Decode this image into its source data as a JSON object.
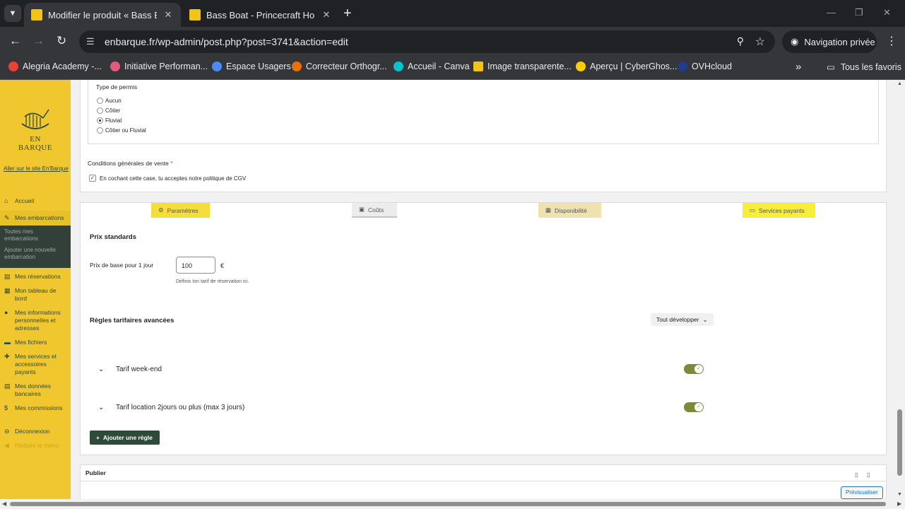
{
  "browser": {
    "tabs": [
      {
        "title": "Modifier le produit « Bass Boat",
        "close": "✕"
      },
      {
        "title": "Bass Boat - Princecraft Holiday",
        "close": "✕"
      }
    ],
    "new_tab": "+",
    "url": "enbarque.fr/wp-admin/post.php?post=3741&action=edit",
    "incognito_label": "Navigation privée",
    "bookmarks": [
      {
        "label": "Alegria Academy -...",
        "color": "#e94235"
      },
      {
        "label": "Initiative Performan...",
        "color": "#e25b7a"
      },
      {
        "label": "Espace Usagers",
        "color": "#4c8bf5"
      },
      {
        "label": "Correcteur Orthogr...",
        "color": "#e8710a"
      },
      {
        "label": "Accueil - Canva",
        "color": "#00c4cc"
      },
      {
        "label": "Image transparente...",
        "color": "#f0c419"
      },
      {
        "label": "Aperçu | CyberGhos...",
        "color": "#ffcc00"
      },
      {
        "label": "OVHcloud",
        "color": "#1f3c88"
      }
    ],
    "all_bookmarks": "Tous les favoris"
  },
  "sidebar": {
    "logo_text": "EN BARQUE",
    "site_link": "Aller sur le site En'Barque",
    "menu": [
      {
        "label": "Accueil",
        "icon": "home-icon",
        "glyph": "⌂"
      },
      {
        "label": "Mes embarcations",
        "icon": "pin-icon",
        "glyph": "✎",
        "active": true
      },
      {
        "label": "Mes réservations",
        "icon": "list-icon",
        "glyph": "▤"
      },
      {
        "label": "Mon tableau de bord",
        "icon": "dashboard-icon",
        "glyph": "▦"
      },
      {
        "label": "Mes informations personnelles et adresses",
        "icon": "user-icon",
        "glyph": "●"
      },
      {
        "label": "Mes fichiers",
        "icon": "folder-icon",
        "glyph": "▬"
      },
      {
        "label": "Mes services et accessoires payants",
        "icon": "tools-icon",
        "glyph": "✚"
      },
      {
        "label": "Mes données bancaires",
        "icon": "bank-icon",
        "glyph": "▤"
      },
      {
        "label": "Mes commissions",
        "icon": "dollar-icon",
        "glyph": "$"
      },
      {
        "label": "Déconnexion",
        "icon": "logout-icon",
        "glyph": "⊖"
      },
      {
        "label": "Réduire le menu",
        "icon": "collapse-icon",
        "glyph": "◀"
      }
    ],
    "submenu": [
      "Toutes mes embarcations",
      "Ajouter une nouvelle embarcation"
    ]
  },
  "form": {
    "permis_title": "Type de permis",
    "permis_options": [
      "Aucun",
      "Côtier",
      "Fluvial",
      "Côtier ou Fluvial"
    ],
    "permis_selected": "Fluvial",
    "cgv_label": "Conditions générales de vente",
    "cgv_required": "*",
    "cgv_checkbox": "En cochant cette case, tu acceptes notre politique de CGV",
    "cgv_checked": true
  },
  "product_tabs": [
    {
      "label": "Paramètres",
      "icon": "gear-icon",
      "glyph": "⚙"
    },
    {
      "label": "Coûts",
      "icon": "money-icon",
      "glyph": "▣"
    },
    {
      "label": "Disponibilité",
      "icon": "calendar-icon",
      "glyph": "▦"
    },
    {
      "label": "Services payants",
      "icon": "box-icon",
      "glyph": "▭"
    }
  ],
  "pricing": {
    "section_title": "Prix standards",
    "base_price_label": "Prix de base pour 1 jour",
    "base_price_value": "100",
    "currency": "€",
    "hint": "Définis ton tarif de réservation ici.",
    "advanced_title": "Règles tarifaires avancées",
    "expand_all": "Tout développer",
    "rules": [
      {
        "label": "Tarif week-end",
        "enabled": true
      },
      {
        "label": "Tarif location 2jours ou plus (max 3 jours)",
        "enabled": true
      }
    ],
    "add_rule": "Ajouter une règle"
  },
  "publish": {
    "title": "Publier",
    "preview": "Prévisualiser"
  }
}
